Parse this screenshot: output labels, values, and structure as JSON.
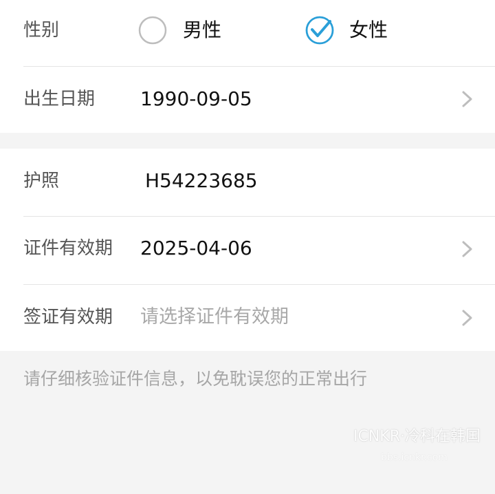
{
  "gender": {
    "label": "性别",
    "options": [
      {
        "label": "男性",
        "selected": false
      },
      {
        "label": "女性",
        "selected": true
      }
    ]
  },
  "birth_date": {
    "label": "出生日期",
    "value": "1990-09-05"
  },
  "passport": {
    "label": "护照",
    "value": "H54223685"
  },
  "id_expiry": {
    "label": "证件有效期",
    "value": "2025-04-06"
  },
  "visa_expiry": {
    "label": "签证有效期",
    "placeholder": "请选择证件有效期"
  },
  "notice": "请仔细核验证件信息，以免耽误您的正常出行",
  "watermark": {
    "main": "ICNKR·冷科在韩国",
    "sub": "bbs.icnkr.com"
  },
  "colors": {
    "accent": "#2a9fd8",
    "radio_off": "#bdbdbd",
    "chevron": "#bdbdbd"
  }
}
